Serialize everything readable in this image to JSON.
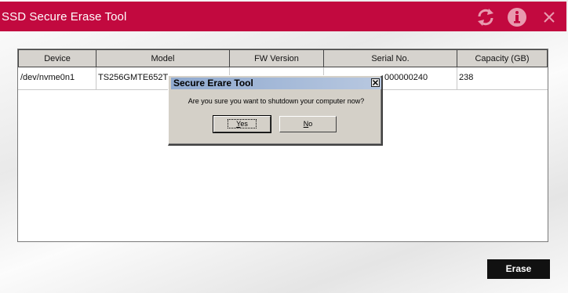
{
  "app": {
    "title": "SSD Secure Erase Tool",
    "accent_color": "#c2093f",
    "toolbar_icons": [
      "refresh-icon",
      "info-icon",
      "close-icon"
    ]
  },
  "table": {
    "columns": [
      "Device",
      "Model",
      "FW Version",
      "Serial No.",
      "Capacity (GB)"
    ],
    "rows": [
      {
        "device": "/dev/nvme0n1",
        "model": "TS256GMTE652T",
        "fw_version": "",
        "serial_no": "000000240",
        "capacity": "238"
      }
    ]
  },
  "dialog": {
    "title": "Secure Erare Tool",
    "message": "Are you sure you want to shutdown your computer now?",
    "yes_label": "Yes",
    "no_label": "No",
    "close_icon": "close-icon"
  },
  "actions": {
    "erase_label": "Erase"
  }
}
